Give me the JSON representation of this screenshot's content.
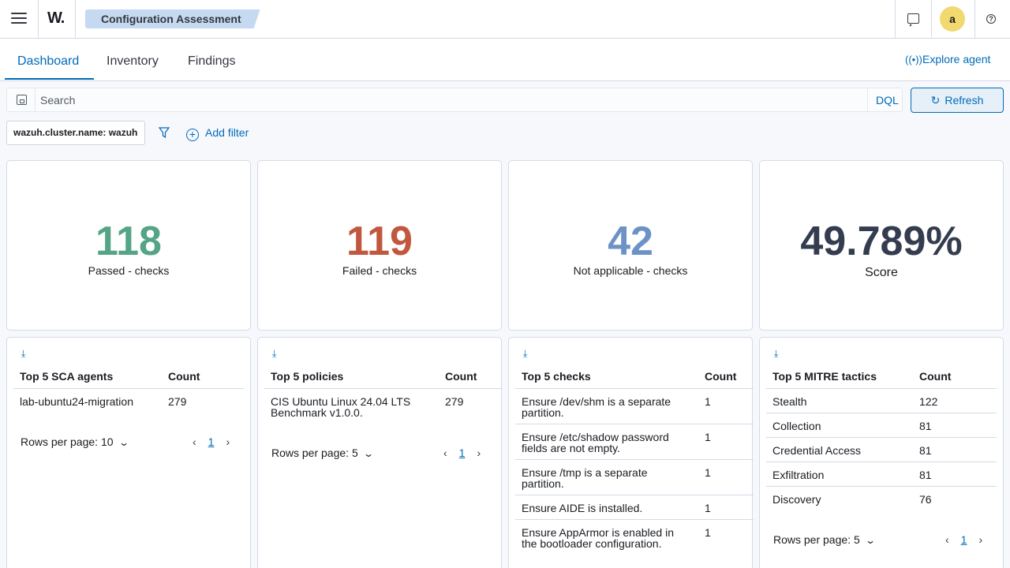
{
  "header": {
    "logo": "W.",
    "breadcrumb": "Configuration Assessment",
    "avatar_letter": "a"
  },
  "tabs": [
    {
      "label": "Dashboard"
    },
    {
      "label": "Inventory"
    },
    {
      "label": "Findings"
    }
  ],
  "explore_agent": "Explore agent",
  "search": {
    "placeholder": "Search",
    "dql": "DQL",
    "refresh": "Refresh"
  },
  "filters": {
    "pill": "wazuh.cluster.name: wazuh",
    "add_filter": "Add filter"
  },
  "metrics": [
    {
      "value": "118",
      "label": "Passed - checks",
      "color": "#54a485"
    },
    {
      "value": "119",
      "label": "Failed - checks",
      "color": "#c2573f"
    },
    {
      "value": "42",
      "label": "Not applicable - checks",
      "color": "#6d93c6"
    },
    {
      "value": "49.789%",
      "label": "Score",
      "color": "#343d4f"
    }
  ],
  "tables": {
    "agents": {
      "col1": "Top 5 SCA agents",
      "col2": "Count",
      "rows": [
        {
          "name": "lab-ubuntu24-migration",
          "count": "279"
        }
      ],
      "rows_per_page": "Rows per page: 10",
      "page": "1"
    },
    "policies": {
      "col1": "Top 5 policies",
      "col2": "Count",
      "rows": [
        {
          "name": "CIS Ubuntu Linux 24.04 LTS Benchmark v1.0.0.",
          "count": "279"
        }
      ],
      "rows_per_page": "Rows per page: 5",
      "page": "1"
    },
    "checks": {
      "col1": "Top 5 checks",
      "col2": "Count",
      "rows": [
        {
          "name": "Ensure /dev/shm is a separate partition.",
          "count": "1"
        },
        {
          "name": "Ensure /etc/shadow password fields are not empty.",
          "count": "1"
        },
        {
          "name": "Ensure /tmp is a separate partition.",
          "count": "1"
        },
        {
          "name": "Ensure AIDE is installed.",
          "count": "1"
        },
        {
          "name": "Ensure AppArmor is enabled in the bootloader configuration.",
          "count": "1"
        }
      ]
    },
    "mitre": {
      "col1": "Top 5 MITRE tactics",
      "col2": "Count",
      "rows": [
        {
          "name": "Stealth",
          "count": "122"
        },
        {
          "name": "Collection",
          "count": "81"
        },
        {
          "name": "Credential Access",
          "count": "81"
        },
        {
          "name": "Exfiltration",
          "count": "81"
        },
        {
          "name": "Discovery",
          "count": "76"
        }
      ],
      "rows_per_page": "Rows per page: 5",
      "page": "1"
    }
  }
}
